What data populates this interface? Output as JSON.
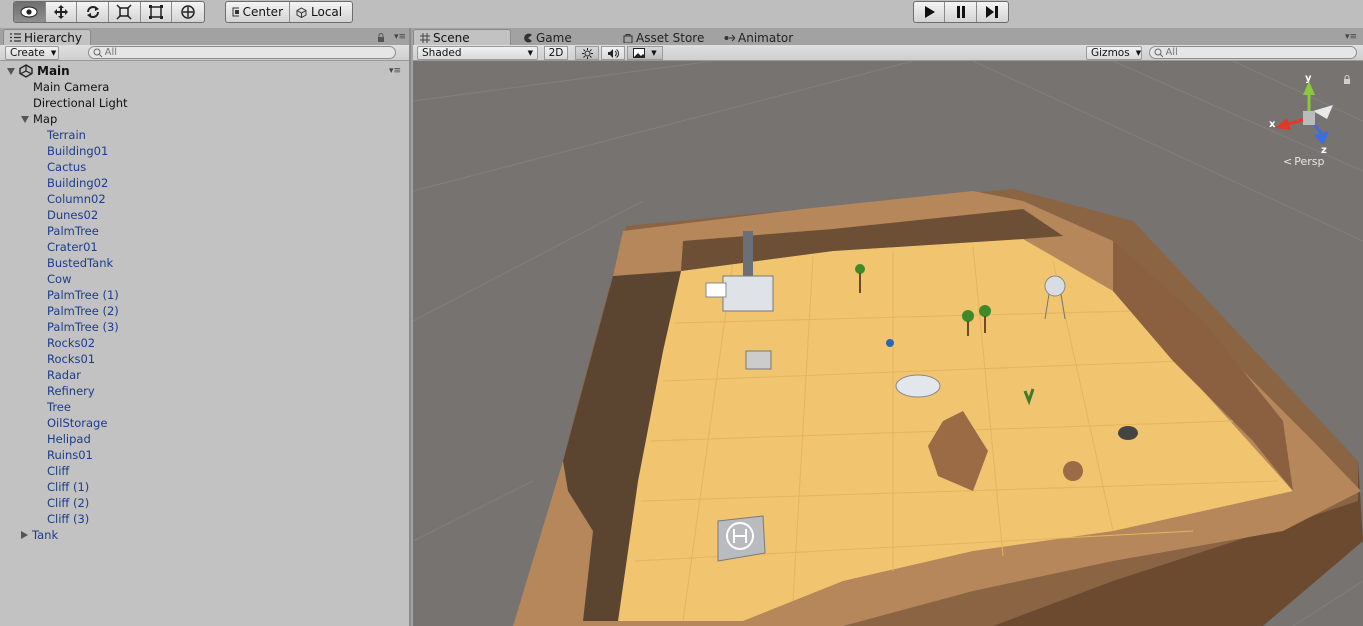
{
  "toolbar": {
    "tools": [
      "view-tool",
      "move-tool",
      "rotate-tool",
      "scale-tool",
      "rect-tool",
      "transform-tool"
    ],
    "pivot_label": "Center",
    "space_label": "Local",
    "playback": [
      "play",
      "pause",
      "step"
    ]
  },
  "hierarchy": {
    "tab_label": "Hierarchy",
    "create_label": "Create",
    "search_placeholder": "All",
    "scene_name": "Main",
    "root_items": [
      {
        "label": "Main Camera"
      },
      {
        "label": "Directional Light"
      },
      {
        "label": "Map",
        "expanded": true
      }
    ],
    "map_children": [
      "Terrain",
      "Building01",
      "Cactus",
      "Building02",
      "Column02",
      "Dunes02",
      "PalmTree",
      "Crater01",
      "BustedTank",
      "Cow",
      "PalmTree (1)",
      "PalmTree (2)",
      "PalmTree (3)",
      "Rocks02",
      "Rocks01",
      "Radar",
      "Refinery",
      "Tree",
      "OilStorage",
      "Helipad",
      "Ruins01",
      "Cliff",
      "Cliff (1)",
      "Cliff (2)",
      "Cliff (3)"
    ],
    "tank_label": "Tank"
  },
  "scene_view": {
    "tabs": [
      {
        "label": "Scene",
        "icon": "grid-icon",
        "active": true
      },
      {
        "label": "Game",
        "icon": "pacman-icon",
        "active": false
      },
      {
        "label": "Asset Store",
        "icon": "bag-icon",
        "active": false
      },
      {
        "label": "Animator",
        "icon": "animator-icon",
        "active": false
      }
    ],
    "shading_mode": "Shaded",
    "mode_2d": "2D",
    "gizmos_label": "Gizmos",
    "search_placeholder": "All",
    "persp_label": "Persp",
    "axis_labels": {
      "x": "x",
      "y": "y",
      "z": "z"
    }
  },
  "colors": {
    "toolbar_bg": "#bebebe",
    "panel_bg": "#c2c2c2",
    "hierarchy_child_text": "#1d3c8c",
    "viewport_bg": "#767371",
    "sand": "#f1c470",
    "cliff": "#b5875a",
    "gizmo_x": "#e0392a",
    "gizmo_y": "#8cc83c",
    "gizmo_z": "#3a6fe0"
  }
}
